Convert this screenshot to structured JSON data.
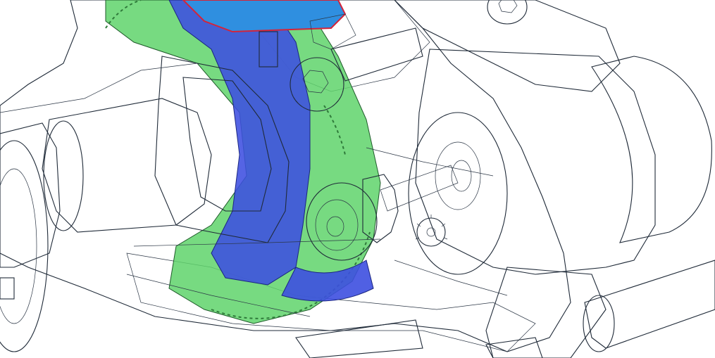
{
  "view": {
    "mode": "cad-3d-viewport",
    "render_style": "transparent-shaded-with-edges"
  },
  "colors": {
    "background": "#ffffff",
    "housing_translucent": "#a9bccd",
    "housing_dark": "#8fa3b8",
    "motor_can": "#aebfd0",
    "motor_endcap_red": "#f47f7f",
    "spur_gear_green": "#5fd36b",
    "ring_blue": "#3d4fe0",
    "pinion_copper": "#e9a57c",
    "small_gear_pink": "#f2a9b5",
    "axle_teal": "#a9c9c4",
    "wheel_beige": "#e6e3c4",
    "steel_gray": "#8a8d93",
    "servo_blue": "#2f8fe0",
    "servo_outline_red": "#d4243a",
    "bearing_mint": "#9fd2cc"
  }
}
